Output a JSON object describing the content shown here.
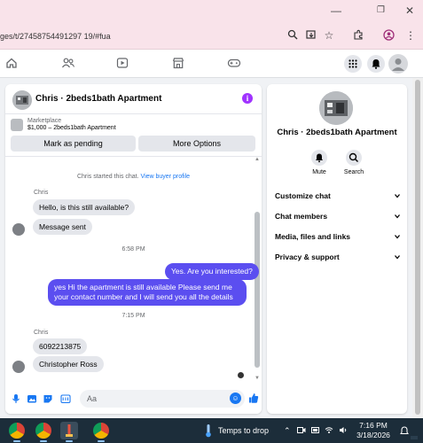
{
  "browser": {
    "url": "ges/t/27458754491297 19/#fua",
    "url_display": "ges/t/27458754491297 19/#fua"
  },
  "chat": {
    "title": "Chris · 2beds1bath Apartment",
    "listing": {
      "label": "Marketplace",
      "price_title": "$1,000 – 2beds1bath Apartment"
    },
    "buttons": {
      "mark_pending": "Mark as pending",
      "more_options": "More Options"
    },
    "system_message": "Chris started this chat.",
    "view_profile_link": "View buyer profile",
    "messages": [
      {
        "sender": "Chris",
        "text": "Hello, is this still available?",
        "direction": "in"
      },
      {
        "text": "Message sent",
        "direction": "in"
      },
      {
        "time": "6:58 PM"
      },
      {
        "text": "Yes. Are you interested?",
        "direction": "out"
      },
      {
        "text": "yes Hi the apartment is still available Please send me your contact number and I will send you all the details",
        "direction": "out"
      },
      {
        "time": "7:15 PM"
      },
      {
        "sender": "Chris",
        "text": "6092213875",
        "direction": "in"
      },
      {
        "text": "Christopher Ross",
        "direction": "in"
      }
    ],
    "composer_placeholder": "Aa"
  },
  "info_panel": {
    "title": "Chris · 2beds1bath Apartment",
    "actions": [
      {
        "label": "Mute",
        "icon": "bell-icon"
      },
      {
        "label": "Search",
        "icon": "search-icon"
      }
    ],
    "sections": [
      "Customize chat",
      "Chat members",
      "Media, files and links",
      "Privacy & support"
    ]
  },
  "taskbar": {
    "weather": "Temps to drop",
    "time": "7:16 PM",
    "date": "3/18/2026"
  },
  "colors": {
    "outgoing_bubble": "#5b4ef0",
    "incoming_bubble": "#e4e6eb",
    "link": "#1877f2",
    "info_icon": "#a033ff"
  }
}
